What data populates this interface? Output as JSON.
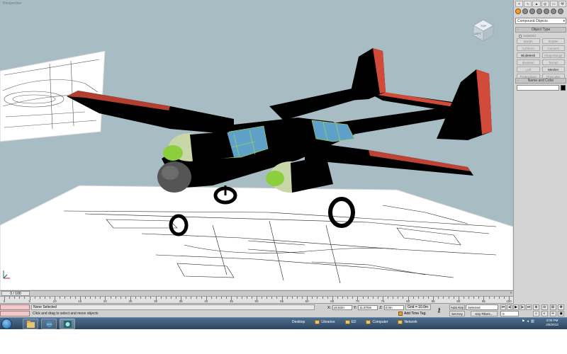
{
  "viewport": {
    "label": "Perspective",
    "viewcube_top": "TOP",
    "viewcube_left": "LEFT"
  },
  "command_panel": {
    "tabs": [
      "+",
      "∿",
      "▲",
      "◎",
      "▭",
      "⚒"
    ],
    "dropdown_value": "Compound Objects",
    "object_type_title": "Object Type",
    "autogrid_label": "AutoGrid",
    "object_buttons": [
      {
        "label": "Morph",
        "active": false
      },
      {
        "label": "Scatter",
        "active": false
      },
      {
        "label": "Conform",
        "active": false
      },
      {
        "label": "Connect",
        "active": false
      },
      {
        "label": "BlobMesh",
        "active": true
      },
      {
        "label": "ShapeMerge",
        "active": false
      },
      {
        "label": "Boolean",
        "active": false
      },
      {
        "label": "Terrain",
        "active": false
      },
      {
        "label": "Loft",
        "active": false
      },
      {
        "label": "Mesher",
        "active": true
      },
      {
        "label": "ProBoolean",
        "active": false
      },
      {
        "label": "ProCutter",
        "active": false
      }
    ],
    "name_color_title": "Name and Color",
    "name_value": "",
    "swatch_color": "#000000"
  },
  "timeline": {
    "slider_text": "0 / 100",
    "track_labels": [
      "0",
      "5",
      "10",
      "15",
      "20",
      "25",
      "30",
      "35",
      "40",
      "45",
      "50",
      "55",
      "60",
      "65",
      "70",
      "75",
      "80",
      "85",
      "90",
      "95",
      "100"
    ]
  },
  "status": {
    "selection": "None Selected",
    "prompt": "Click and drag to select and move objects",
    "x_label": "X:",
    "x_value": "19.62m",
    "y_label": "Y:",
    "y_value": "11.876m",
    "z_label": "Z:",
    "z_value": "0.0m",
    "grid": "Grid = 10.0m",
    "add_time_tag": "Add Time Tag",
    "auto_key": "Auto Key",
    "set_key": "Set Key",
    "selected_dropdown": "Selected",
    "key_filters": "Key Filters...",
    "frame_value": "0",
    "playback": [
      "⏮",
      "◂|",
      "▶",
      "|▸",
      "⏭"
    ],
    "nav_icons": [
      "⊕",
      "⊖",
      "⊞",
      "✥",
      "⌕",
      "◐",
      "☩",
      "▣"
    ]
  },
  "taskbar": {
    "desktop": "Desktop",
    "libraries": "Libraries",
    "ed": "ED",
    "computer": "Computer",
    "network": "Network",
    "time": "3:00 PM",
    "date": "2/8/2013"
  },
  "colors": {
    "viewport_bg": "#a8bcc4",
    "plane_body": "#000000",
    "plane_accent": "#d24a3a",
    "nacelle": "#c9d6a8",
    "spinner": "#8ccf3c",
    "canopy": "#5ea0c8",
    "nose": "#555555"
  }
}
